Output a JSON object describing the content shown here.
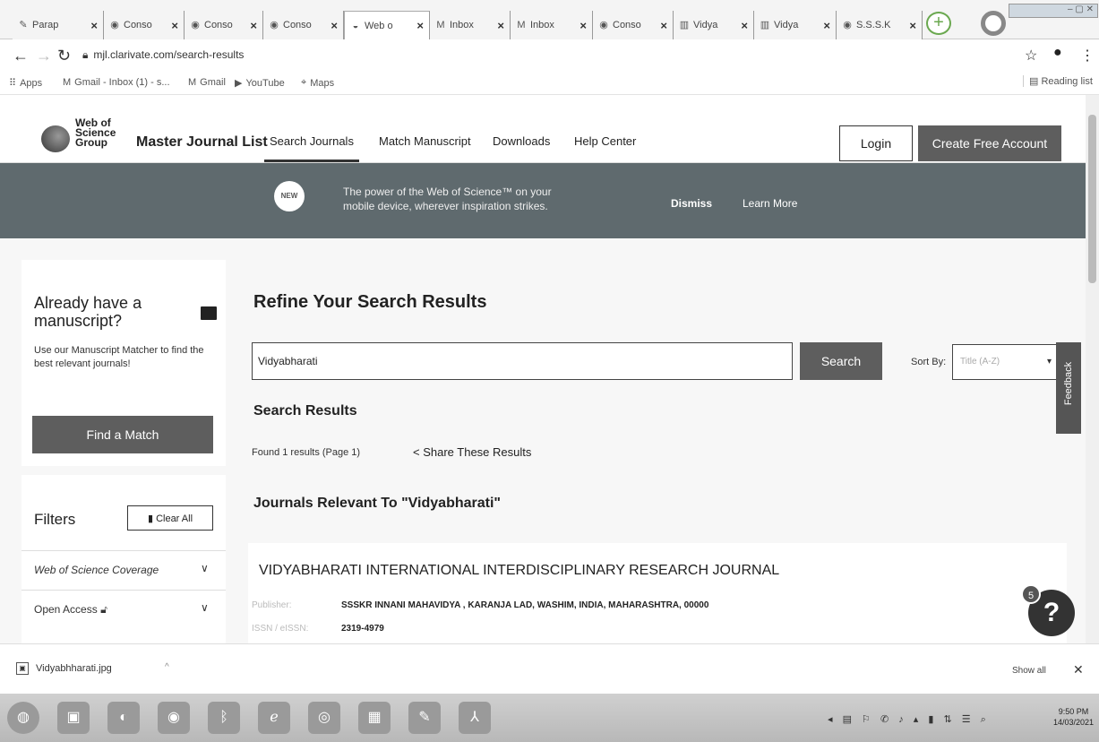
{
  "browser": {
    "tabs": [
      {
        "label": "Parap",
        "icon": "paraphrase-icon"
      },
      {
        "label": "Conso",
        "icon": "chrome-icon"
      },
      {
        "label": "Conso",
        "icon": "chrome-icon"
      },
      {
        "label": "Conso",
        "icon": "chrome-icon"
      },
      {
        "label": "Web o",
        "icon": "web-of-science-icon",
        "active": true
      },
      {
        "label": "Inbox",
        "icon": "gmail-icon"
      },
      {
        "label": "Inbox",
        "icon": "gmail-icon"
      },
      {
        "label": "Conso",
        "icon": "chrome-icon"
      },
      {
        "label": "Vidya",
        "icon": "page-icon"
      },
      {
        "label": "Vidya",
        "icon": "page-icon"
      },
      {
        "label": "S.S.S.K",
        "icon": "chrome-icon"
      }
    ],
    "url": "mjl.clarivate.com/search-results",
    "bookmarks": [
      {
        "label": "Apps",
        "icon": "apps-grid-icon"
      },
      {
        "label": "Gmail - Inbox (1) - s...",
        "icon": "gmail-icon"
      },
      {
        "label": "Gmail",
        "icon": "gmail-icon"
      },
      {
        "label": "YouTube",
        "icon": "youtube-icon"
      },
      {
        "label": "Maps",
        "icon": "maps-icon"
      }
    ],
    "reading_list": "Reading list"
  },
  "header": {
    "logo_lines": [
      "Web of",
      "Science",
      "Group"
    ],
    "title": "Master Journal List",
    "nav": [
      "Search Journals",
      "Match Manuscript",
      "Downloads",
      "Help Center"
    ],
    "login": "Login",
    "create_account": "Create Free Account"
  },
  "banner": {
    "icon_text": "NEW",
    "text": "The power of the Web of Science™ on your mobile device, wherever inspiration strikes.",
    "dismiss": "Dismiss",
    "learn_more": "Learn More"
  },
  "sidebar": {
    "manuscript_title": "Already have a manuscript?",
    "manuscript_text": "Use our Manuscript Matcher to find the best relevant journals!",
    "find_match": "Find a Match",
    "filters_title": "Filters",
    "clear_all": "Clear All",
    "filters": [
      "Web of Science Coverage",
      "Open Access"
    ]
  },
  "main": {
    "refine_title": "Refine Your Search Results",
    "search_value": "Vidyabharati",
    "search_button": "Search",
    "sort_label": "Sort By:",
    "sort_value": "Title (A-Z)",
    "results_title": "Search Results",
    "found": "Found 1 results (Page 1)",
    "share": "Share These Results",
    "relevant": "Journals Relevant To \"Vidyabharati\"",
    "result": {
      "title": "VIDYABHARATI INTERNATIONAL INTERDISCIPLINARY RESEARCH JOURNAL",
      "publisher_label": "Publisher:",
      "publisher": "SSSKR INNANI MAHAVIDYA , KARANJA LAD, WASHIM, INDIA, MAHARASHTRA, 00000",
      "issn_label": "ISSN / eISSN:",
      "issn": "2319-4979"
    }
  },
  "widgets": {
    "feedback": "Feedback",
    "help_symbol": "?",
    "help_count": "5"
  },
  "download": {
    "file": "Vidyabhharati.jpg",
    "show_all": "Show all"
  },
  "taskbar": {
    "time": "9:50 PM",
    "date": "14/03/2021"
  }
}
